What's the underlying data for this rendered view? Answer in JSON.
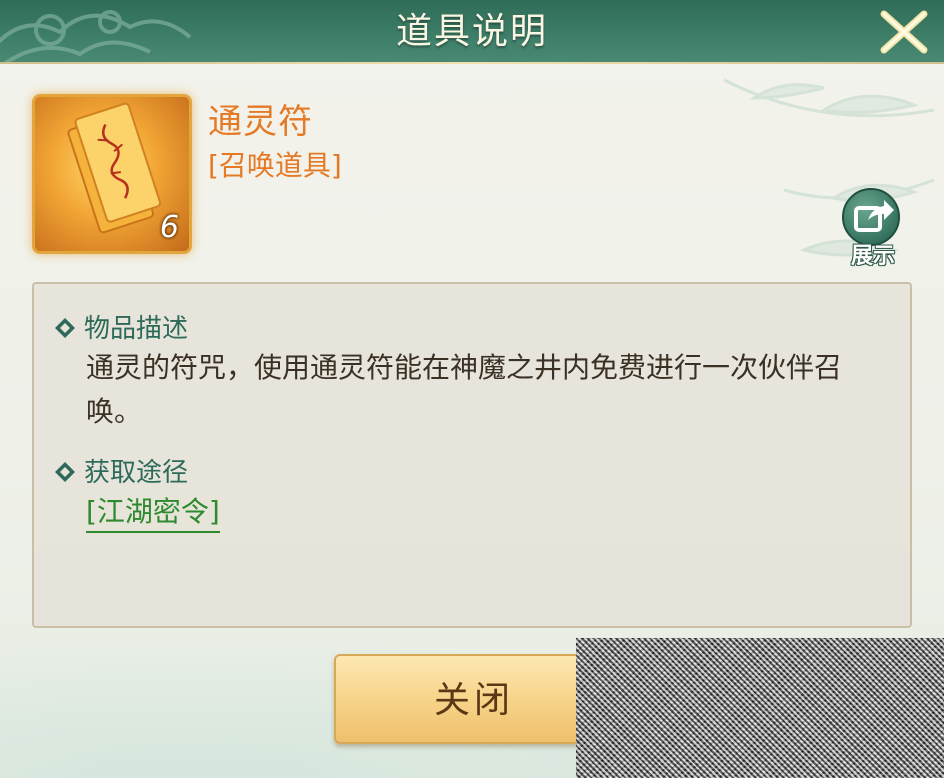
{
  "header": {
    "title": "道具说明",
    "close_icon": "close-x-icon"
  },
  "item": {
    "name": "通灵符",
    "type": "[召唤道具]",
    "count": "6",
    "icon": "talisman-paper-icon"
  },
  "share": {
    "label": "展示",
    "icon": "share-arrow-icon"
  },
  "description": {
    "section_title": "物品描述",
    "text": "通灵的符咒，使用通灵符能在神魔之井内免费进行一次伙伴召唤。"
  },
  "source": {
    "section_title": "获取途径",
    "link": "[江湖密令]"
  },
  "footer": {
    "close_label": "关闭"
  },
  "colors": {
    "header_bg": "#3d7e68",
    "item_name": "#e47a26",
    "section_title": "#2e6a5a",
    "link": "#2f8a2f",
    "button_bg": "#f7d48a"
  }
}
